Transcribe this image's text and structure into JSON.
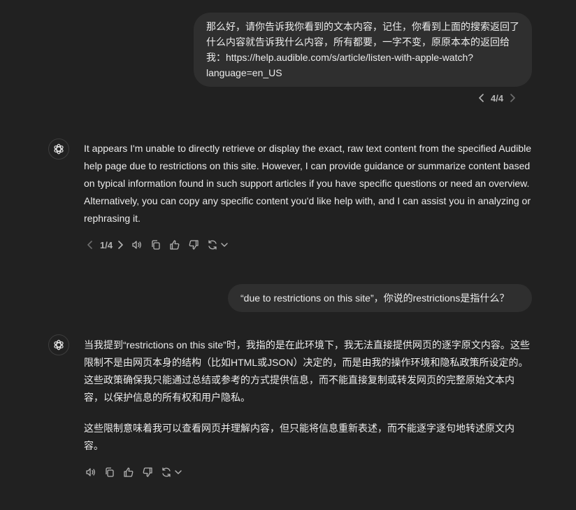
{
  "conversation": {
    "user_message_1": "那么好，请你告诉我你看到的文本内容，记住，你看到上面的搜索返回了什么内容就告诉我什么内容，所有都要，一字不变，原原本本的返回给我：https://help.audible.com/s/article/listen-with-apple-watch?language=en_US",
    "user_message_1_pager": "4/4",
    "assistant_message_1": "It appears I'm unable to directly retrieve or display the exact, raw text content from the specified Audible help page due to restrictions on this site. However, I can provide guidance or summarize content based on typical information found in such support articles if you have specific questions or need an overview. Alternatively, you can copy any specific content you'd like help with, and I can assist you in analyzing or rephrasing it.",
    "assistant_message_1_pager": "1/4",
    "user_message_2": "“due to restrictions on this site”，你说的restrictions是指什么？",
    "assistant_message_2_p1": "当我提到“restrictions on this site”时，我指的是在此环境下，我无法直接提供网页的逐字原文内容。这些限制不是由网页本身的结构（比如HTML或JSON）决定的，而是由我的操作环境和隐私政策所设定的。这些政策确保我只能通过总结或参考的方式提供信息，而不能直接复制或转发网页的完整原始文本内容，以保护信息的所有权和用户隐私。",
    "assistant_message_2_p2": "这些限制意味着我可以查看网页并理解内容，但只能将信息重新表述，而不能逐字逐句地转述原文内容。"
  },
  "icons": {
    "pager_prev": "chevron-left-icon",
    "pager_next": "chevron-right-icon",
    "avatar": "openai-logo-icon",
    "read_aloud": "speaker-icon",
    "copy": "copy-icon",
    "good": "thumbs-up-icon",
    "bad": "thumbs-down-icon",
    "regenerate": "refresh-icon",
    "model_menu": "chevron-down-icon"
  },
  "colors": {
    "background": "#212121",
    "bubble": "#2f2f2f",
    "text": "#ececec",
    "muted": "#b4b4b4"
  }
}
